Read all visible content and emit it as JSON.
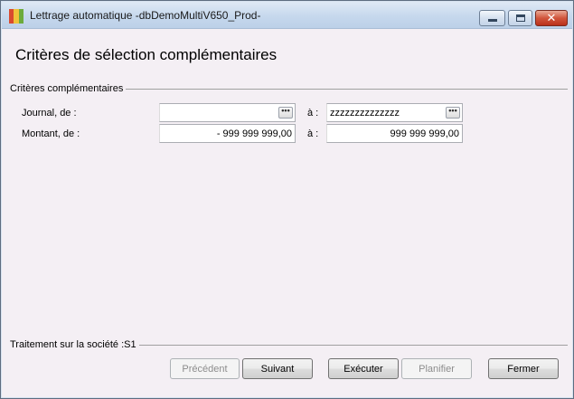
{
  "window": {
    "title": "Lettrage automatique -dbDemoMultiV650_Prod-",
    "icon_colors": [
      "#d94a2f",
      "#f0c23a",
      "#6cab3c"
    ],
    "controls": {
      "minimize": "minimize-icon",
      "maximize": "maximize-icon",
      "close": "close-icon"
    }
  },
  "page": {
    "title": "Critères de sélection complémentaires"
  },
  "criteria": {
    "group_label": "Critères complémentaires",
    "journal": {
      "label": "Journal, de :",
      "from_value": "",
      "to_label": "à  :",
      "to_value": "zzzzzzzzzzzzzz",
      "lookup_glyph": "•••"
    },
    "montant": {
      "label": "Montant, de :",
      "from_value": "- 999 999 999,00",
      "to_label": "à  :",
      "to_value": "999 999 999,00"
    }
  },
  "status": {
    "text": "Traitement sur la société :S1"
  },
  "buttons": {
    "previous": "Précédent",
    "next": "Suivant",
    "execute": "Exécuter",
    "schedule": "Planifier",
    "close": "Fermer"
  }
}
